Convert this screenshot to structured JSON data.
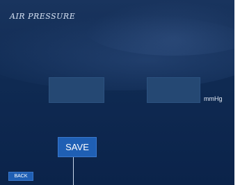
{
  "screen": {
    "title": "AIR PRESSURE",
    "unit_label": "mmHg",
    "save_label": "SAVE",
    "back_label": "BACK"
  },
  "colors": {
    "background": "#102c54",
    "field": "#254873",
    "button": "#1f5fb4"
  }
}
